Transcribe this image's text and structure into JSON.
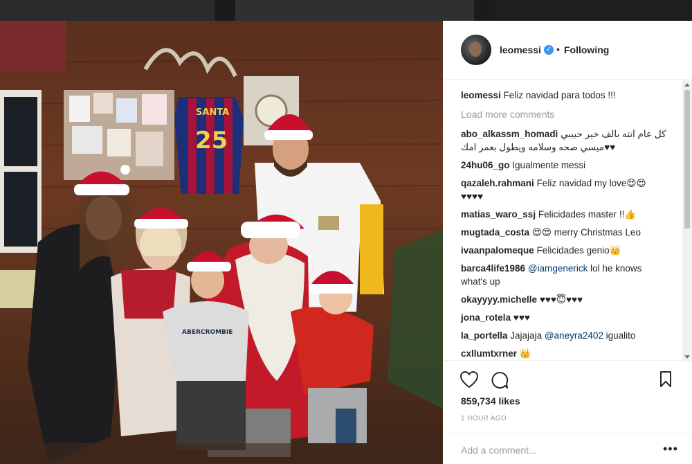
{
  "post": {
    "username": "leomessi",
    "verified_badge": "✓",
    "separator": "•",
    "follow_status": "Following",
    "jersey_name": "SANTA",
    "jersey_number": "25",
    "sweater_text": "ABERCROMBIE"
  },
  "comments": {
    "load_more": "Load more comments",
    "items": [
      {
        "user": "leomessi",
        "text": "Feliz navidad para todos !!!"
      },
      {
        "user": "abo_alkassm_homadi",
        "text": "كل عام انته بالف خير حبيبي",
        "text2": "♥♥ميسي صحه وسلامه ويطول بعمر امك"
      },
      {
        "user": "24hu06_go",
        "text": "Igualmente messi"
      },
      {
        "user": "qazaleh.rahmani",
        "text": "Feliz navidad my love😍😍",
        "text2": "♥♥♥♥"
      },
      {
        "user": "matias_waro_ssj",
        "text": "Felicidades master !!👍"
      },
      {
        "user": "mugtada_costa",
        "text": "😍😍 merry Christmas Leo"
      },
      {
        "user": "ivaanpalomeque",
        "text": "Felicidades genio👑"
      },
      {
        "user": "barca4life1986",
        "mention": "@iamgenerick",
        "text": "lol he knows",
        "text2": "what's up"
      },
      {
        "user": "okayyyy.michelle",
        "text": "♥♥♥😇♥♥♥"
      },
      {
        "user": "jona_rotela",
        "text": "♥♥♥"
      },
      {
        "user": "la_portella",
        "text": "Jajajaja",
        "mention": "@aneyra2402",
        "text_after": "igualito"
      },
      {
        "user": "cxllumtxrner",
        "text": "👑"
      }
    ]
  },
  "actions": {
    "likes": "859,734 likes",
    "time": "1 HOUR AGO",
    "add_comment_placeholder": "Add a comment...",
    "more_label": "•••",
    "icons": [
      "heart-icon",
      "comment-icon",
      "bookmark-icon"
    ]
  },
  "colors": {
    "accent": "#3897f0",
    "mention": "#003569",
    "muted": "#999999",
    "text": "#262626"
  }
}
